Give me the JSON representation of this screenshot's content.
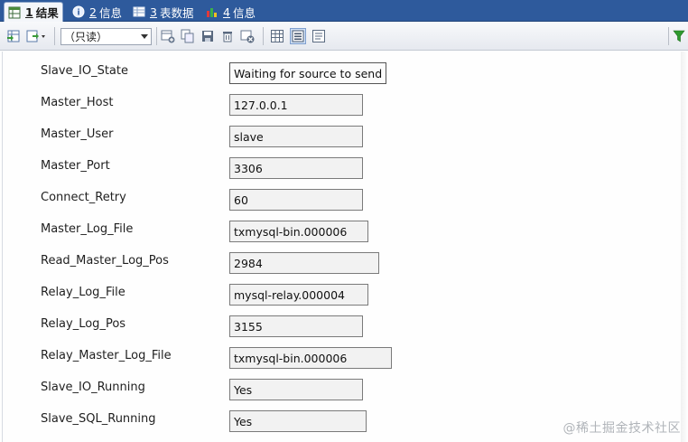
{
  "tabs": [
    {
      "num": "1",
      "label": "结果",
      "icon": "result-grid-icon"
    },
    {
      "num": "2",
      "label": "信息",
      "icon": "info-icon"
    },
    {
      "num": "3",
      "label": "表数据",
      "icon": "table-data-icon"
    },
    {
      "num": "4",
      "label": "信息",
      "icon": "info-chart-icon"
    }
  ],
  "toolbar": {
    "mode_value": "（只读）"
  },
  "fields": [
    {
      "label": "Slave_IO_State",
      "value": "Waiting for source to send e"
    },
    {
      "label": "Master_Host",
      "value": "127.0.0.1"
    },
    {
      "label": "Master_User",
      "value": "slave"
    },
    {
      "label": "Master_Port",
      "value": "3306"
    },
    {
      "label": "Connect_Retry",
      "value": "60"
    },
    {
      "label": "Master_Log_File",
      "value": "txmysql-bin.000006"
    },
    {
      "label": "Read_Master_Log_Pos",
      "value": "2984"
    },
    {
      "label": "Relay_Log_File",
      "value": "mysql-relay.000004"
    },
    {
      "label": "Relay_Log_Pos",
      "value": "3155"
    },
    {
      "label": "Relay_Master_Log_File",
      "value": "txmysql-bin.000006"
    },
    {
      "label": "Slave_IO_Running",
      "value": "Yes"
    },
    {
      "label": "Slave_SQL_Running",
      "value": "Yes"
    }
  ],
  "watermark": "@稀土掘金技术社区",
  "colors": {
    "tabbar": "#2e5a9c",
    "field_bg": "#f2f2f2",
    "field_border": "#7a7a7a"
  }
}
